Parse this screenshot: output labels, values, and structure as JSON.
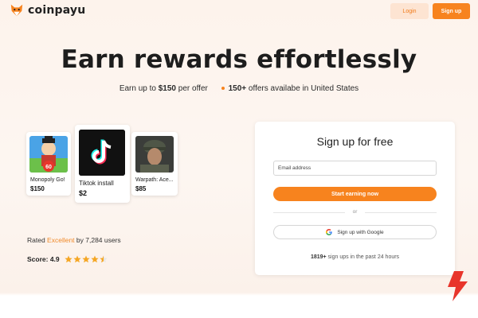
{
  "header": {
    "logo_text": "coinpayu",
    "login_label": "Login",
    "signup_label": "Sign up"
  },
  "hero": {
    "title": "Earn rewards effortlessly",
    "sub_prefix": "Earn up to ",
    "sub_amount": "$150",
    "sub_suffix": " per offer",
    "offers_count": "150+",
    "offers_text": " offers availabe in United States"
  },
  "offers": [
    {
      "name": "Monopoly Go!",
      "price": "$150",
      "icon": "monopoly-go-game-icon"
    },
    {
      "name": "Tiktok install",
      "price": "$2",
      "icon": "tiktok-icon"
    },
    {
      "name": "Warpath: Ace...",
      "price": "$85",
      "icon": "warpath-game-icon"
    }
  ],
  "rating": {
    "prefix": "Rated ",
    "word": "Excellent",
    "suffix": " by 7,284 users",
    "score_label": "Score: 4.9",
    "stars": 4.5
  },
  "signup_panel": {
    "title": "Sign up for free",
    "email_placeholder": "Email address",
    "start_label": "Start earning now",
    "or_text": "or",
    "google_label": "Sign up with Google",
    "signups_count": "1819+",
    "signups_text": " sign ups in the past 24 hours"
  },
  "colors": {
    "accent": "#f7831e",
    "accent_light": "#fde4d2",
    "bolt": "#e8352b"
  }
}
